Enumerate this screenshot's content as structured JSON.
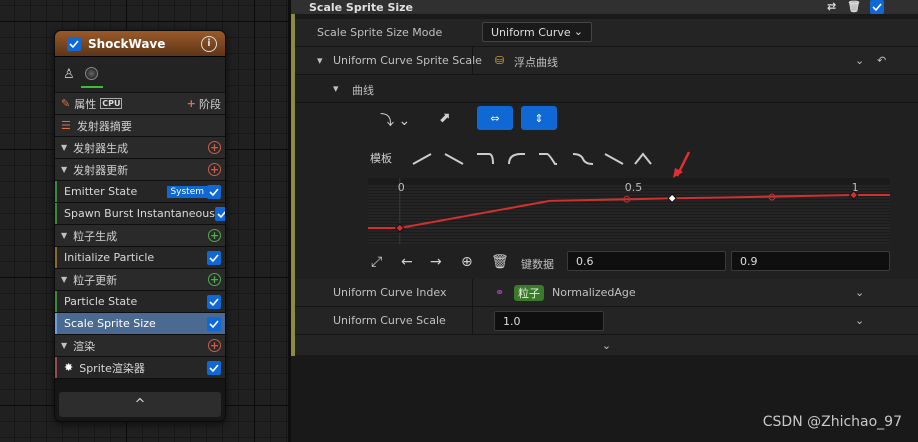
{
  "node": {
    "title": "ShockWave",
    "info": "i",
    "cpu": "CPU",
    "props": "属性",
    "stage": "阶段",
    "summary": "发射器摘要",
    "expand": "^",
    "rows": [
      {
        "label": "发射器生成",
        "kind": "section",
        "plus": "red"
      },
      {
        "label": "发射器更新",
        "kind": "section",
        "plus": "red"
      },
      {
        "label": "Emitter State",
        "kind": "module",
        "cls": "upd",
        "tag": "System",
        "check": true
      },
      {
        "label": "Spawn Burst Instantaneous",
        "kind": "module",
        "cls": "upd",
        "check": true
      },
      {
        "label": "粒子生成",
        "kind": "section",
        "plus": "green"
      },
      {
        "label": "Initialize Particle",
        "kind": "module",
        "cls": "spawn",
        "check": true
      },
      {
        "label": "粒子更新",
        "kind": "section",
        "plus": "green"
      },
      {
        "label": "Particle State",
        "kind": "module",
        "cls": "upd",
        "check": true
      },
      {
        "label": "Scale Sprite Size",
        "kind": "module",
        "cls": "sel",
        "check": true
      },
      {
        "label": "渲染",
        "kind": "section",
        "plus": "red"
      },
      {
        "label": "Sprite渲染器",
        "kind": "module",
        "cls": "ren",
        "check": true
      }
    ]
  },
  "details": {
    "title": "Scale Sprite Size",
    "mode_label": "Scale Sprite Size Mode",
    "mode_value": "Uniform Curve",
    "curve_label": "Uniform Curve Sprite Scale",
    "curve_type": "浮点曲线",
    "curve_group": "曲线",
    "template_label": "模板",
    "key_label": "键数据",
    "key_time": "0.6",
    "key_value": "0.9",
    "index_label": "Uniform Curve Index",
    "index_badge": "粒子",
    "index_value": "NormalizedAge",
    "scale_label": "Uniform Curve Scale",
    "scale_value": "1.0",
    "axis_ticks": [
      "0",
      "0.5",
      "1"
    ]
  },
  "chart_data": {
    "type": "line",
    "x": [
      0,
      0.33,
      0.5,
      0.6,
      0.7,
      1.0,
      1.1
    ],
    "y": [
      0.0,
      0.82,
      0.87,
      0.9,
      0.92,
      1.0,
      1.0
    ],
    "xlim": [
      -0.07,
      1.08
    ],
    "keys": [
      {
        "x": 0,
        "y": 0
      },
      {
        "x": 0.6,
        "y": 0.9
      },
      {
        "x": 1.0,
        "y": 1.0
      }
    ],
    "series_color": "#d03030"
  },
  "watermark": "CSDN @Zhichao_97"
}
